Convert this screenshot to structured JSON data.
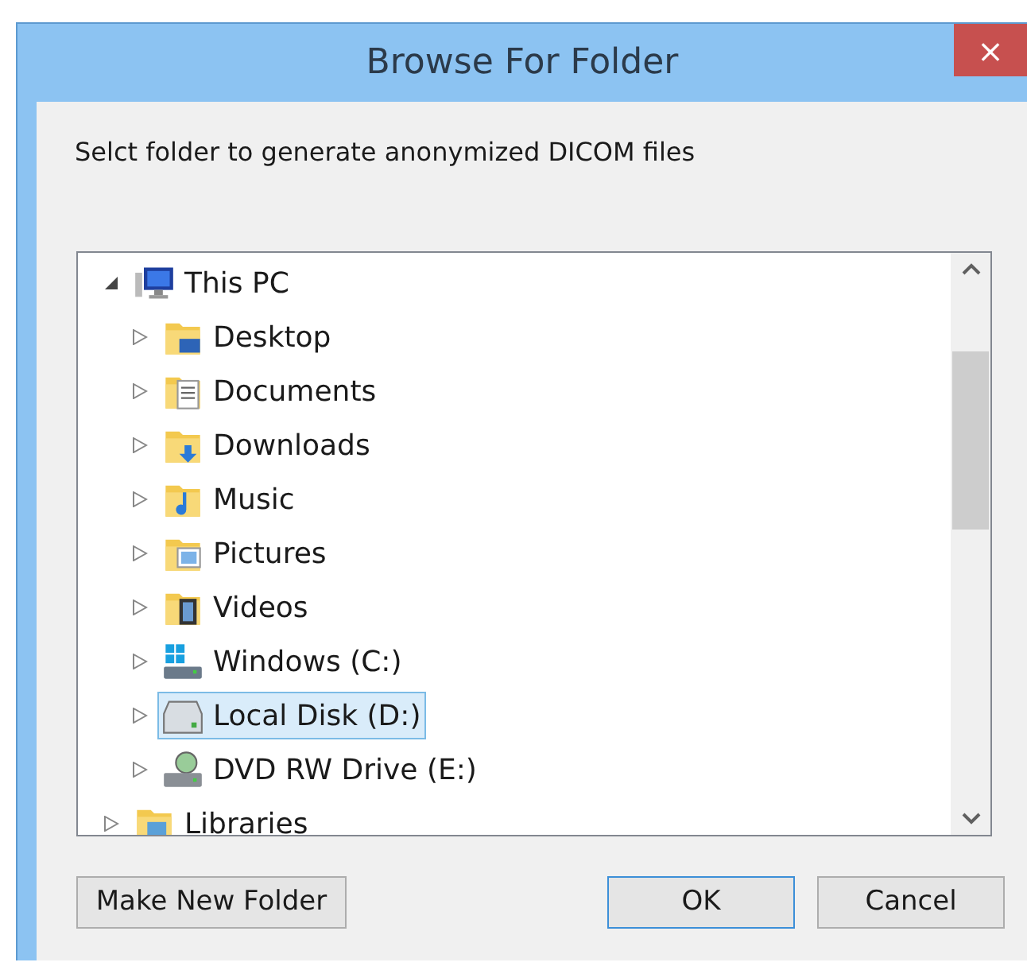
{
  "window": {
    "title": "Browse For Folder",
    "close": "×"
  },
  "prompt": "Selct folder to generate anonymized DICOM files",
  "tree": [
    {
      "label": "This PC",
      "kind": "computer",
      "expanded": true,
      "selected": false,
      "children": [
        {
          "label": "Desktop",
          "kind": "desktop",
          "expanded": false,
          "selected": false
        },
        {
          "label": "Documents",
          "kind": "documents",
          "expanded": false,
          "selected": false
        },
        {
          "label": "Downloads",
          "kind": "downloads",
          "expanded": false,
          "selected": false
        },
        {
          "label": "Music",
          "kind": "music",
          "expanded": false,
          "selected": false
        },
        {
          "label": "Pictures",
          "kind": "pictures",
          "expanded": false,
          "selected": false
        },
        {
          "label": "Videos",
          "kind": "videos",
          "expanded": false,
          "selected": false
        },
        {
          "label": "Windows (C:)",
          "kind": "system-drive",
          "expanded": false,
          "selected": false
        },
        {
          "label": "Local Disk (D:)",
          "kind": "drive",
          "expanded": false,
          "selected": true
        },
        {
          "label": "DVD RW Drive (E:)",
          "kind": "dvd-drive",
          "expanded": false,
          "selected": false
        }
      ]
    },
    {
      "label": "Libraries",
      "kind": "libraries",
      "expanded": false,
      "selected": false
    }
  ],
  "buttons": [
    {
      "label": "Make New Folder",
      "kind": "left",
      "default": false
    },
    {
      "label": "OK",
      "kind": "right",
      "default": true
    },
    {
      "label": "Cancel",
      "kind": "right",
      "default": false
    }
  ]
}
